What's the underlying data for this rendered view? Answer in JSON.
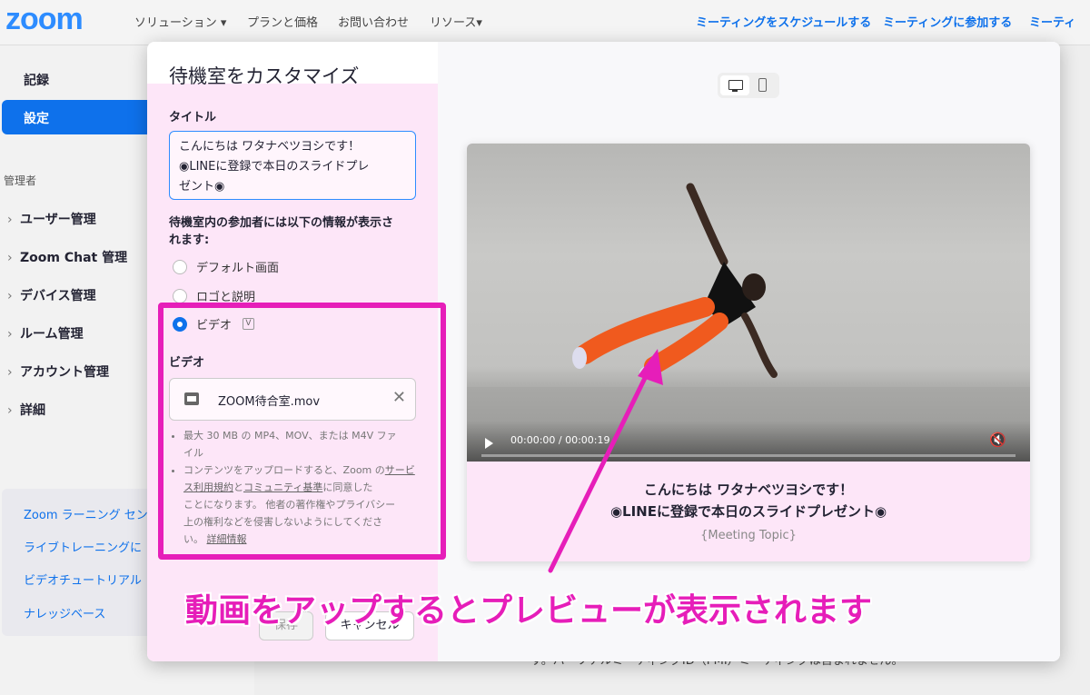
{
  "nav": {
    "logo": "zoom",
    "items": [
      "ソリューション ▾",
      "プランと価格",
      "お問い合わせ",
      "リソース▾"
    ],
    "right_items": [
      "ミーティングをスケジュールする",
      "ミーティングに参加する",
      "ミーティ"
    ]
  },
  "sidebar": {
    "record": "記録",
    "settings": "設定",
    "admin_section": "管理者",
    "menu": [
      "ユーザー管理",
      "Zoom Chat 管理",
      "デバイス管理",
      "ルーム管理",
      "アカウント管理",
      "詳細"
    ],
    "learning": [
      "Zoom ラーニング セン",
      "ライブトレーニングに",
      "ビデオチュートリアル",
      "ナレッジベース"
    ]
  },
  "modal": {
    "title": "待機室をカスタマイズ",
    "title_label": "タイトル",
    "title_value_line1": "こんにちは ワタナベツヨシです！",
    "title_value_line2": "◉LINEに登録で本日のスライドプレ",
    "title_value_line3": "ゼント◉",
    "display_label_line1": "待機室内の参加者には以下の情報が表示さ",
    "display_label_line2": "れます:",
    "options": [
      {
        "label": "デフォルト画面",
        "selected": false
      },
      {
        "label": "ロゴと説明",
        "selected": false
      },
      {
        "label": "ビデオ",
        "selected": true
      }
    ],
    "v_badge": "V",
    "video_label": "ビデオ",
    "file_name": "ZOOM待合室.mov",
    "close": "✕",
    "note1_line1": "最大 30 MB の MP4、MOV、または M4V ファ",
    "note1_line2": "イル",
    "note2_a": "コンテンツをアップロードすると、Zoom の",
    "note2_link1": "サービス利用規約",
    "note2_b": "と",
    "note2_link2": "コミュニティ基準",
    "note2_c": "に同意した",
    "note2_line3": "ことになります。 他者の著作権やプライバシー",
    "note2_line4": "上の権利などを侵害しないようにしてくださ",
    "note2_line5": "い。",
    "note2_link3": "詳細情報",
    "save": "保存",
    "cancel": "キャンセル"
  },
  "preview": {
    "time": "00:00:00 / 00:00:19",
    "mute": "🔇",
    "title_line1": "こんにちは ワタナベツヨシです！",
    "title_line2": "◉LINEに登録で本日のスライドプレゼント◉",
    "topic": "{Meeting Topic}"
  },
  "annotation": {
    "text": "動画をアップするとプレビューが表示されます",
    "color": "#e61eb9"
  },
  "background_text": "す。パーソナルミーティングID（PMI）ミーティングは含まれません。"
}
